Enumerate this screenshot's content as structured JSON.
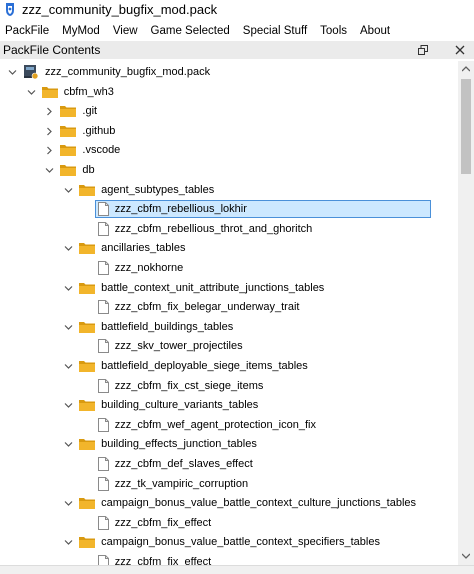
{
  "window": {
    "title": "zzz_community_bugfix_mod.pack"
  },
  "menu": [
    "PackFile",
    "MyMod",
    "View",
    "Game Selected",
    "Special Stuff",
    "Tools",
    "About"
  ],
  "panel": {
    "title": "PackFile Contents"
  },
  "colors": {
    "folder": "#f2b52b",
    "folder_dark": "#d99a10",
    "selection": "#cce8ff",
    "selection_border": "#4a90d9"
  },
  "tree": [
    {
      "label": "zzz_community_bugfix_mod.pack",
      "depth": 0,
      "type": "pack",
      "expanded": true
    },
    {
      "label": "cbfm_wh3",
      "depth": 1,
      "type": "folder",
      "expanded": true
    },
    {
      "label": ".git",
      "depth": 2,
      "type": "folder",
      "expanded": false
    },
    {
      "label": ".github",
      "depth": 2,
      "type": "folder",
      "expanded": false
    },
    {
      "label": ".vscode",
      "depth": 2,
      "type": "folder",
      "expanded": false
    },
    {
      "label": "db",
      "depth": 2,
      "type": "folder",
      "expanded": true
    },
    {
      "label": "agent_subtypes_tables",
      "depth": 3,
      "type": "folder",
      "expanded": true
    },
    {
      "label": "zzz_cbfm_rebellious_lokhir",
      "depth": 4,
      "type": "file",
      "selected": true
    },
    {
      "label": "zzz_cbfm_rebellious_throt_and_ghoritch",
      "depth": 4,
      "type": "file"
    },
    {
      "label": "ancillaries_tables",
      "depth": 3,
      "type": "folder",
      "expanded": true
    },
    {
      "label": "zzz_nokhorne",
      "depth": 4,
      "type": "file"
    },
    {
      "label": "battle_context_unit_attribute_junctions_tables",
      "depth": 3,
      "type": "folder",
      "expanded": true
    },
    {
      "label": "zzz_cbfm_fix_belegar_underway_trait",
      "depth": 4,
      "type": "file"
    },
    {
      "label": "battlefield_buildings_tables",
      "depth": 3,
      "type": "folder",
      "expanded": true
    },
    {
      "label": "zzz_skv_tower_projectiles",
      "depth": 4,
      "type": "file"
    },
    {
      "label": "battlefield_deployable_siege_items_tables",
      "depth": 3,
      "type": "folder",
      "expanded": true
    },
    {
      "label": "zzz_cbfm_fix_cst_siege_items",
      "depth": 4,
      "type": "file"
    },
    {
      "label": "building_culture_variants_tables",
      "depth": 3,
      "type": "folder",
      "expanded": true
    },
    {
      "label": "zzz_cbfm_wef_agent_protection_icon_fix",
      "depth": 4,
      "type": "file"
    },
    {
      "label": "building_effects_junction_tables",
      "depth": 3,
      "type": "folder",
      "expanded": true
    },
    {
      "label": "zzz_cbfm_def_slaves_effect",
      "depth": 4,
      "type": "file"
    },
    {
      "label": "zzz_tk_vampiric_corruption",
      "depth": 4,
      "type": "file"
    },
    {
      "label": "campaign_bonus_value_battle_context_culture_junctions_tables",
      "depth": 3,
      "type": "folder",
      "expanded": true
    },
    {
      "label": "zzz_cbfm_fix_effect",
      "depth": 4,
      "type": "file"
    },
    {
      "label": "campaign_bonus_value_battle_context_specifiers_tables",
      "depth": 3,
      "type": "folder",
      "expanded": true
    },
    {
      "label": "zzz_cbfm_fix_effect",
      "depth": 4,
      "type": "file"
    }
  ]
}
